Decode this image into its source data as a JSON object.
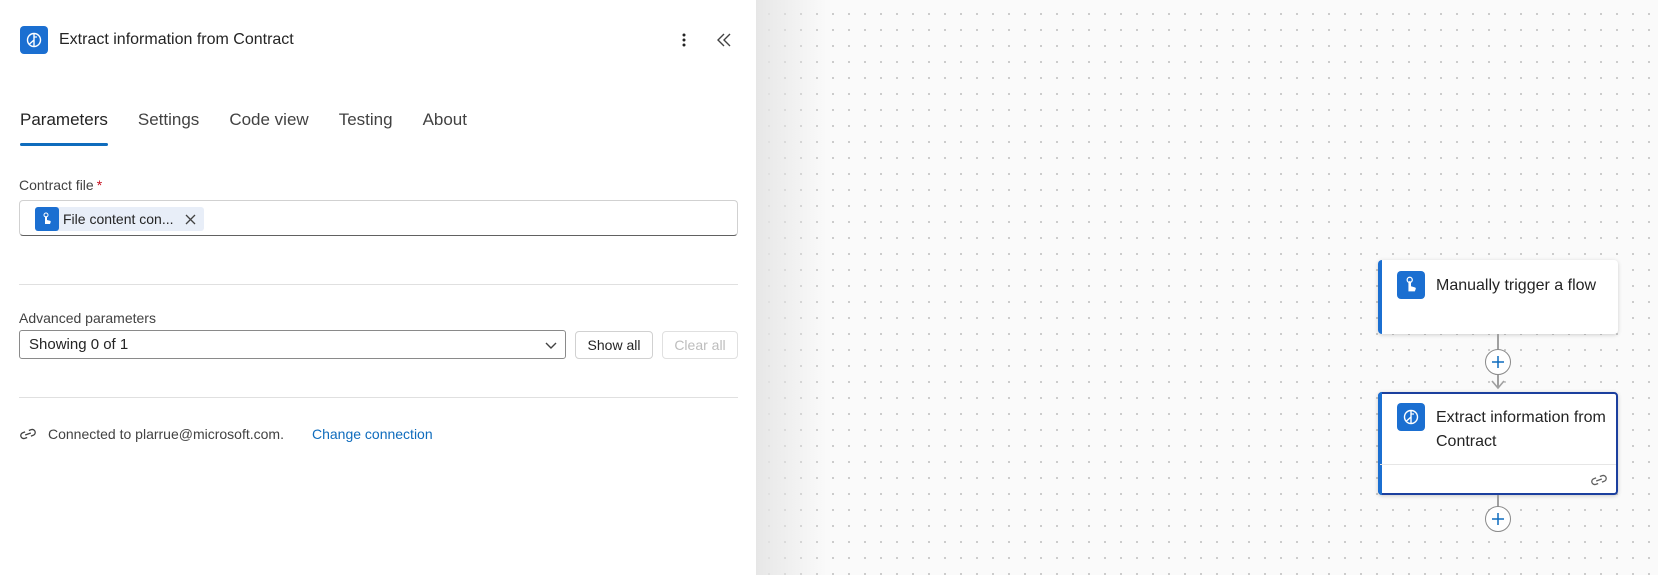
{
  "panel": {
    "title": "Extract information from Contract",
    "tabs": [
      {
        "label": "Parameters",
        "active": true
      },
      {
        "label": "Settings",
        "active": false
      },
      {
        "label": "Code view",
        "active": false
      },
      {
        "label": "Testing",
        "active": false
      },
      {
        "label": "About",
        "active": false
      }
    ],
    "contract_file": {
      "label": "Contract file",
      "required_mark": "*",
      "token_text": "File content con..."
    },
    "advanced": {
      "label": "Advanced parameters",
      "select_value": "Showing 0 of 1",
      "show_all": "Show all",
      "clear_all": "Clear all"
    },
    "connection": {
      "text": "Connected to plarrue@microsoft.com.",
      "link": "Change connection"
    }
  },
  "canvas": {
    "nodes": [
      {
        "title": "Manually trigger a flow",
        "icon": "touch-trigger-icon"
      },
      {
        "title": "Extract information from Contract",
        "icon": "ai-brain-icon"
      }
    ]
  },
  "colors": {
    "accent": "#1b6fd1",
    "link": "#0f6cbd",
    "selected_border": "#1b3f9e",
    "required": "#c50f1f"
  }
}
